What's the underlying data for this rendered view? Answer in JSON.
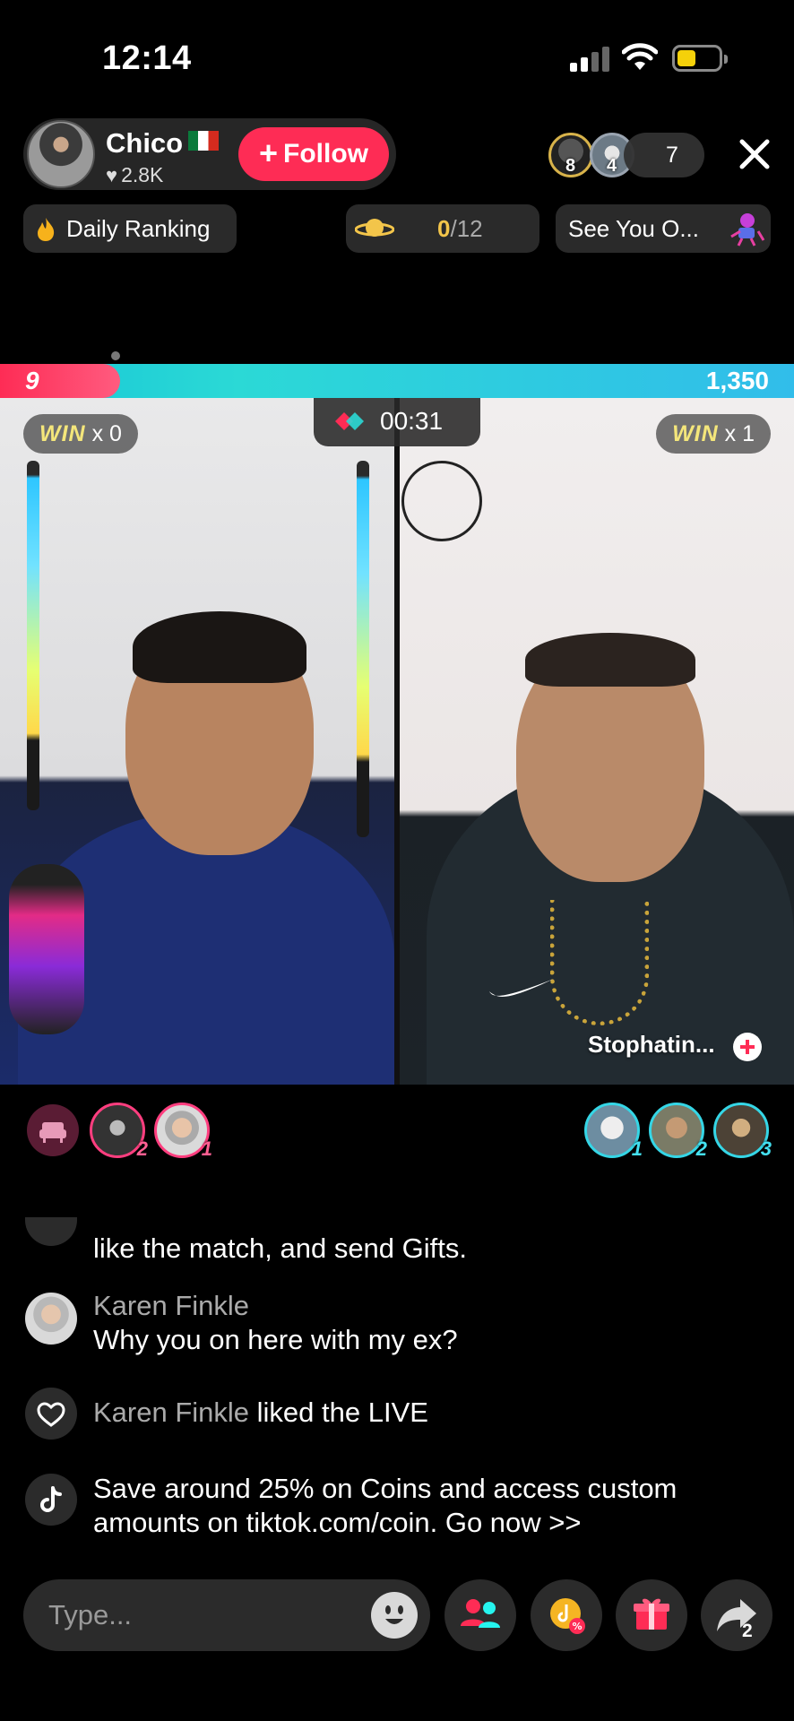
{
  "status_bar": {
    "time": "12:14"
  },
  "host": {
    "name": "Chico",
    "likes": "2.8K",
    "follow_label": "Follow"
  },
  "viewers": {
    "badge_1": "8",
    "badge_2": "4",
    "count": "7"
  },
  "info_row": {
    "daily_ranking": "Daily Ranking",
    "progress_current": "0",
    "progress_total": "/12",
    "see_you": "See You O..."
  },
  "battle": {
    "left_score": "9",
    "right_score": "1,350",
    "timer": "00:31",
    "win_label": "WIN",
    "left_wins": "x 0",
    "right_wins": "x 1",
    "opponent_name": "Stophatin..."
  },
  "gifters": {
    "left": [
      {
        "rank": "2"
      },
      {
        "rank": "1"
      }
    ],
    "right": [
      {
        "rank": "1"
      },
      {
        "rank": "2"
      },
      {
        "rank": "3"
      }
    ]
  },
  "chat": {
    "partial_message": "like the match, and send Gifts.",
    "messages": [
      {
        "user": "Karen Finkle",
        "text": "Why you on here with my ex?"
      },
      {
        "user": "Karen Finkle",
        "text": "liked the LIVE"
      },
      {
        "text_line1": "Save around 25% on Coins and access custom",
        "text_line2": "amounts on tiktok.com/coin. Go now >>"
      }
    ]
  },
  "bottom_bar": {
    "input_placeholder": "Type...",
    "share_count": "2"
  },
  "colors": {
    "accent": "#fe2c55",
    "battle_blue": "#31bdea",
    "win_yellow": "#f4e67b"
  },
  "icons": [
    "signal-icon",
    "wifi-icon",
    "battery-icon",
    "heart-icon",
    "close-icon",
    "flame-icon",
    "planet-icon",
    "battle-icon",
    "seat-icon",
    "tiktok-icon",
    "emoji-icon",
    "multi-guest-icon",
    "coin-discount-icon",
    "gift-icon",
    "share-icon"
  ]
}
